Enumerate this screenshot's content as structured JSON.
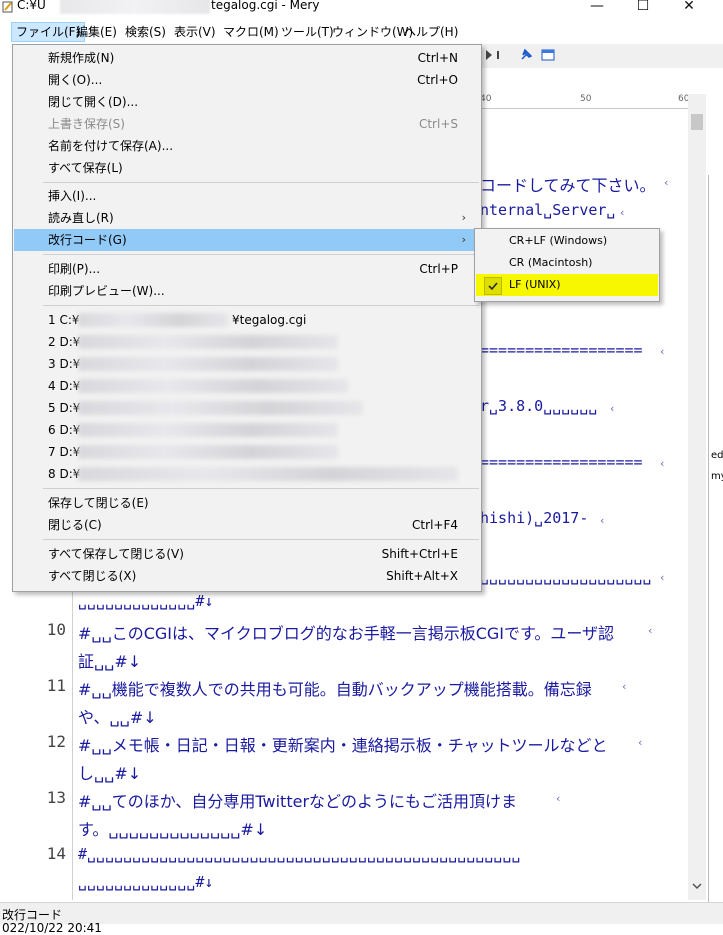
{
  "window": {
    "title_prefix": "C:¥U",
    "title_suffix": "tegalog.cgi - Mery",
    "min_glyph": "—",
    "max_glyph": "☐",
    "close_glyph": "✕"
  },
  "menubar": [
    {
      "label": "ファイル(F)"
    },
    {
      "label": "編集(E)"
    },
    {
      "label": "検索(S)"
    },
    {
      "label": "表示(V)"
    },
    {
      "label": "マクロ(M)"
    },
    {
      "label": "ツール(T)"
    },
    {
      "label": "ウィンドウ(W)"
    },
    {
      "label": "ヘルプ(H)"
    }
  ],
  "ruler": {
    "t1": "40",
    "t2": "50",
    "t3": "60"
  },
  "editor": {
    "visible_fragments": [
      "コードしてみて下さい。",
      "nternal␣Server␣",
      "==================",
      "r␣3.8.0␣␣␣␣␣␣",
      "==================",
      "hishi)␣2017-",
      "␣␣␣␣␣␣␣␣␣␣␣␣␣␣␣␣␣␣␣"
    ],
    "lines": [
      {
        "num": "",
        "text": "␣␣␣␣␣␣␣␣␣␣␣␣␣#↓"
      },
      {
        "num": "10",
        "text": "#␣␣このCGIは、マイクロブログ的なお手軽一言掲示板CGIです。ユーザ認"
      },
      {
        "num": "",
        "text": "証␣␣#↓"
      },
      {
        "num": "11",
        "text": "#␣␣機能で複数人での共用も可能。自動バックアップ機能搭載。備忘録"
      },
      {
        "num": "",
        "text": "や、␣␣#↓"
      },
      {
        "num": "12",
        "text": "#␣␣メモ帳・日記・日報・更新案内・連絡掲示板・チャットツールなどと"
      },
      {
        "num": "",
        "text": "し␣␣#↓"
      },
      {
        "num": "13",
        "text": "#␣␣てのほか、自分専用Twitterなどのようにもご活用頂けま"
      },
      {
        "num": "",
        "text": "す。␣␣␣␣␣␣␣␣␣␣␣␣␣#↓"
      },
      {
        "num": "14",
        "text": "#␣␣␣␣␣␣␣␣␣␣␣␣␣␣␣␣␣␣␣␣␣␣␣␣␣␣␣␣␣␣␣␣␣␣␣␣␣␣␣␣␣␣␣␣␣␣␣␣"
      },
      {
        "num": "",
        "text": "␣␣␣␣␣␣␣␣␣␣␣␣␣#↓"
      }
    ],
    "wrap_mark": "‹"
  },
  "file_menu": {
    "items": [
      {
        "label": "新規作成(N)",
        "shortcut": "Ctrl+N"
      },
      {
        "label": "開く(O)...",
        "shortcut": "Ctrl+O"
      },
      {
        "label": "閉じて開く(D)...",
        "shortcut": ""
      },
      {
        "label": "上書き保存(S)",
        "shortcut": "Ctrl+S"
      },
      {
        "label": "名前を付けて保存(A)...",
        "shortcut": ""
      },
      {
        "label": "すべて保存(L)",
        "shortcut": ""
      },
      {
        "label": "挿入(I)...",
        "shortcut": ""
      },
      {
        "label": "読み直し(R)",
        "shortcut": ""
      },
      {
        "label": "改行コード(G)",
        "shortcut": ""
      },
      {
        "label": "印刷(P)...",
        "shortcut": "Ctrl+P"
      },
      {
        "label": "印刷プレビュー(W)...",
        "shortcut": ""
      },
      {
        "label": "1 C:¥",
        "suffix": "¥tegalog.cgi"
      },
      {
        "label": "2 D:¥"
      },
      {
        "label": "3 D:¥"
      },
      {
        "label": "4 D:¥"
      },
      {
        "label": "5 D:¥"
      },
      {
        "label": "6 D:¥"
      },
      {
        "label": "7 D:¥"
      },
      {
        "label": "8 D:¥"
      },
      {
        "label": "保存して閉じる(E)",
        "shortcut": ""
      },
      {
        "label": "閉じる(C)",
        "shortcut": "Ctrl+F4"
      },
      {
        "label": "すべて保存して閉じる(V)",
        "shortcut": "Shift+Ctrl+E"
      },
      {
        "label": "すべて閉じる(X)",
        "shortcut": "Shift+Alt+X"
      }
    ],
    "submenu_arrow": "›"
  },
  "newline_submenu": {
    "items": [
      {
        "label": "CR+LF (Windows)"
      },
      {
        "label": "CR (Macintosh)"
      },
      {
        "label": "LF (UNIX)"
      }
    ],
    "selected_index": 2,
    "highlight_color": "#f7f700"
  },
  "side_fragments": {
    "a": "ed",
    "b": "my"
  },
  "statusbar": {
    "text": "改行コード",
    "bottom_text": "022/10/22 20:41"
  },
  "colors": {
    "menu_highlight": "#91c9f7",
    "editor_text": "#1a1aa0",
    "menubar_active": "#cce8ff"
  }
}
